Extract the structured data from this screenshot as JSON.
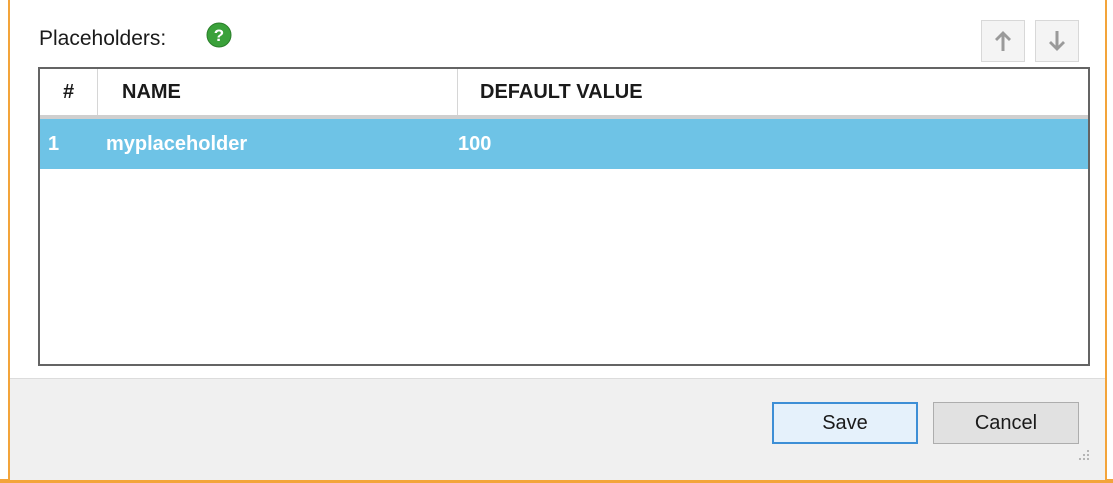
{
  "header": {
    "label": "Placeholders:",
    "help_icon": "help-question-icon",
    "move_up_icon": "arrow-up-icon",
    "move_down_icon": "arrow-down-icon"
  },
  "table": {
    "columns": [
      "#",
      "NAME",
      "DEFAULT VALUE"
    ],
    "rows": [
      {
        "index": "1",
        "name": "myplaceholder",
        "default_value": "100",
        "selected": true
      }
    ],
    "selection_color": "#6ec3e6"
  },
  "footer": {
    "save_label": "Save",
    "cancel_label": "Cancel"
  },
  "colors": {
    "frame_accent": "#f3a43a",
    "help_icon": "#3aa13a"
  }
}
